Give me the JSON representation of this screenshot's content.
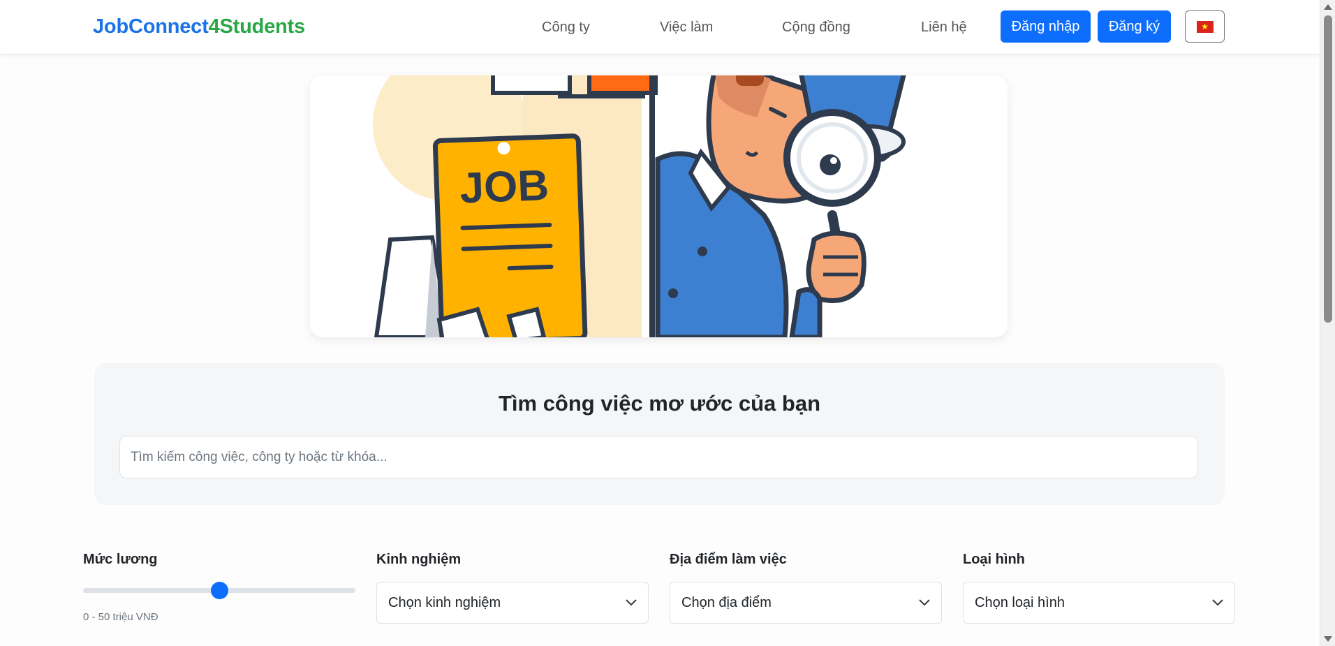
{
  "brand": {
    "part1": "JobConnect",
    "part2": "4Students"
  },
  "nav": {
    "links": [
      "Công ty",
      "Việc làm",
      "Cộng đồng",
      "Liên hệ"
    ],
    "login": "Đăng nhập",
    "register": "Đăng ký",
    "language_icon": "vietnam-flag-icon"
  },
  "hero": {
    "image_text": "JOB"
  },
  "search": {
    "title": "Tìm công việc mơ ước của bạn",
    "placeholder": "Tìm kiếm công việc, công ty hoặc từ khóa..."
  },
  "filters": {
    "salary": {
      "label": "Mức lương",
      "range_text": "0 - 50 triệu VNĐ",
      "slider_value": 0.5
    },
    "experience": {
      "label": "Kinh nghiệm",
      "selected": "Chọn kinh nghiệm"
    },
    "location": {
      "label": "Địa điểm làm việc",
      "selected": "Chọn địa điểm"
    },
    "type": {
      "label": "Loại hình",
      "selected": "Chọn loại hình"
    }
  },
  "colors": {
    "primary": "#0d6efd",
    "brand_blue": "#1a73e8",
    "brand_green": "#28a745"
  }
}
